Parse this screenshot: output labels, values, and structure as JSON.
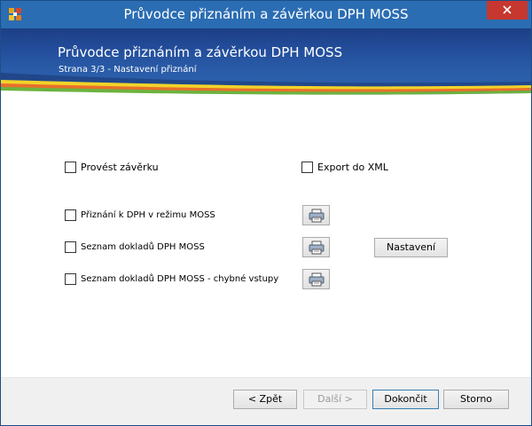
{
  "window": {
    "title": "Průvodce přiznáním a závěrkou DPH MOSS"
  },
  "header": {
    "title": "Průvodce přiznáním a závěrkou DPH MOSS",
    "subtitle": "Strana 3/3 - Nastavení přiznání"
  },
  "options": {
    "provest_zaverku": {
      "label": "Provést závěrku",
      "checked": false
    },
    "export_xml": {
      "label": "Export do XML",
      "checked": false
    },
    "priznani": {
      "label": "Přiznání k DPH v režimu MOSS",
      "checked": false
    },
    "seznam": {
      "label": "Seznam dokladů DPH MOSS",
      "checked": false
    },
    "seznam_chybne": {
      "label": "Seznam dokladů DPH MOSS - chybné vstupy",
      "checked": false
    }
  },
  "buttons": {
    "nastaveni": "Nastavení",
    "zpet": "< Zpět",
    "dalsi": "Další >",
    "dokoncit": "Dokončit",
    "storno": "Storno"
  },
  "colors": {
    "titlebar": "#2b6db3",
    "banner": "#24509e",
    "close": "#c7372f"
  }
}
